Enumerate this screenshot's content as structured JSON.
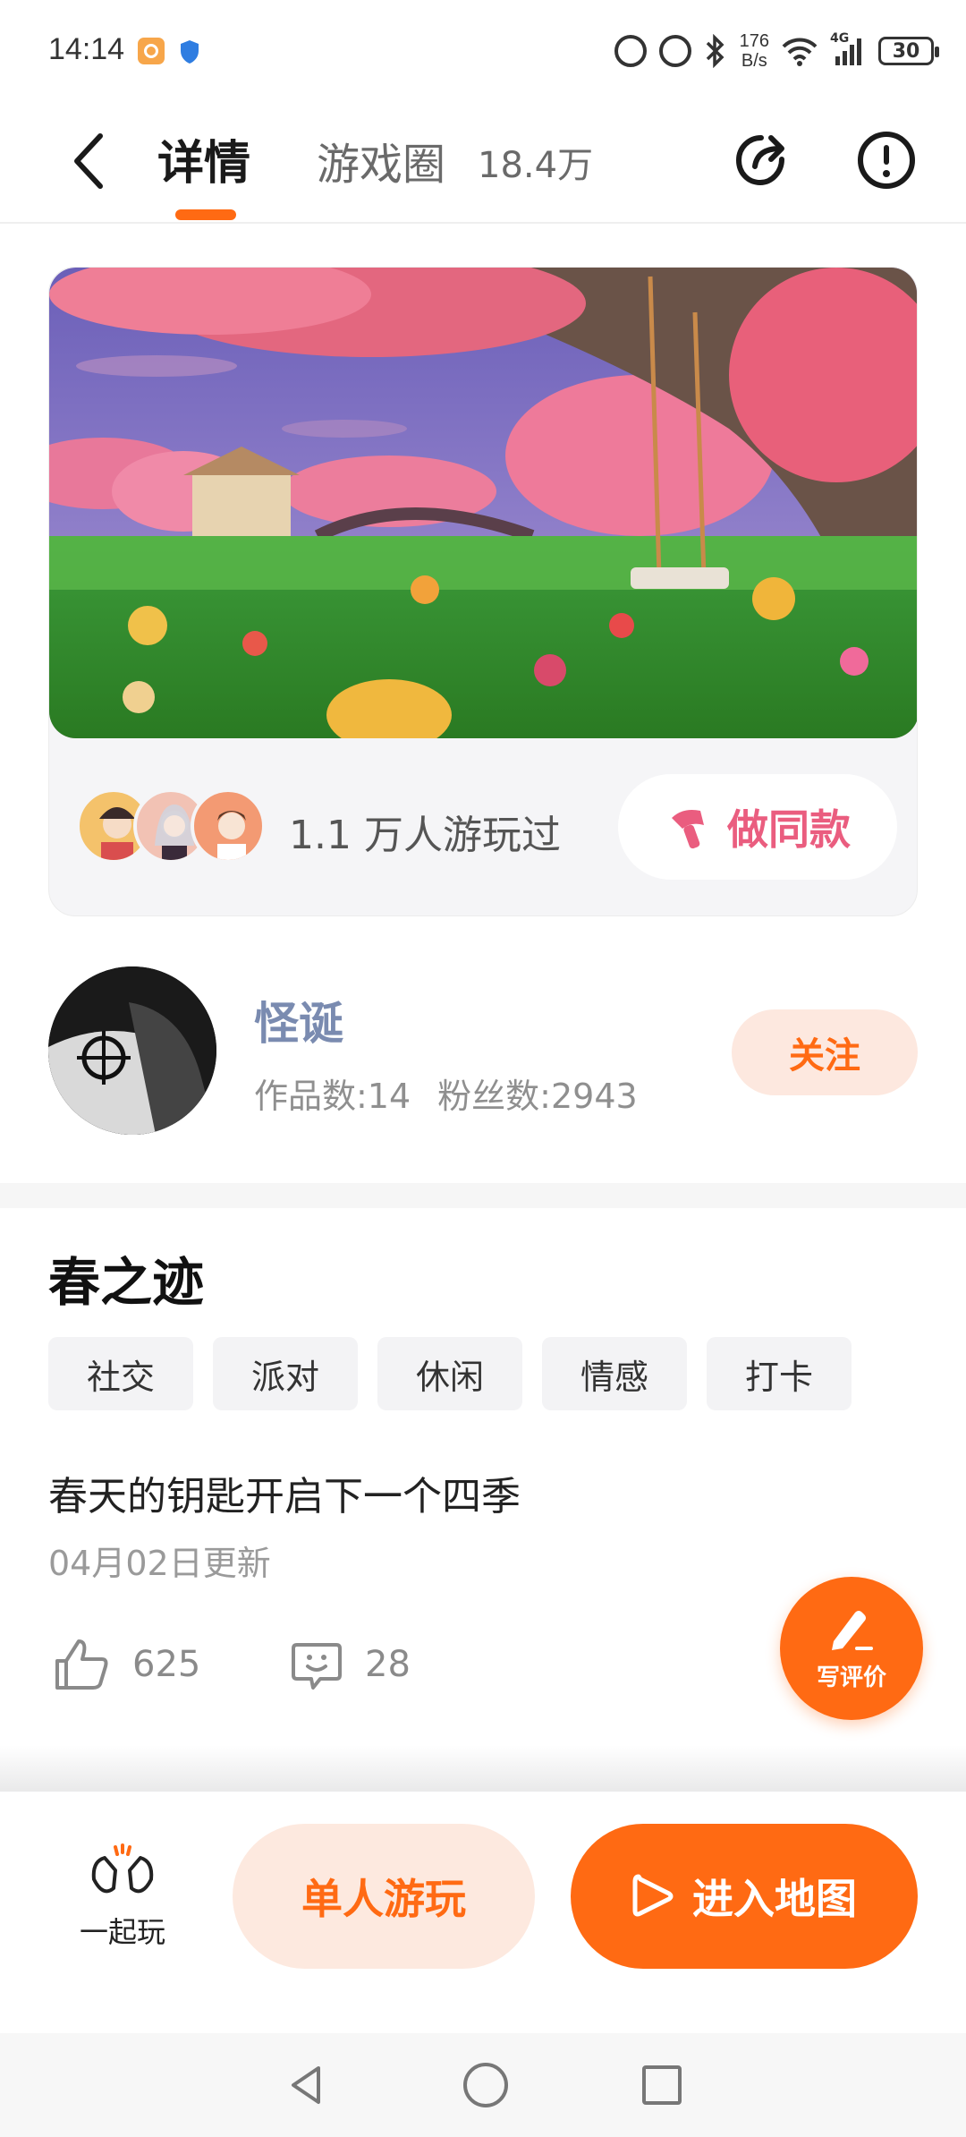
{
  "status_bar": {
    "time": "14:14",
    "net_speed_value": "176",
    "net_speed_unit": "B/s",
    "network": "4G",
    "battery": "30"
  },
  "nav": {
    "tab_detail": "详情",
    "tab_circle": "游戏圈",
    "tab_circle_count": "18.4万"
  },
  "game_card": {
    "played_text": "1.1 万人游玩过",
    "make_same_label": "做同款"
  },
  "author": {
    "name": "怪诞",
    "works": "作品数:14",
    "fans": "粉丝数:2943",
    "follow_label": "关注"
  },
  "game": {
    "title": "春之迹",
    "tags": [
      "社交",
      "派对",
      "休闲",
      "情感",
      "打卡"
    ],
    "description": "春天的钥匙开启下一个四季",
    "updated": "04月02日更新",
    "likes": "625",
    "comments": "28",
    "review_label": "写评价"
  },
  "actions": {
    "together_label": "一起玩",
    "solo_label": "单人游玩",
    "enter_label": "进入地图"
  },
  "colors": {
    "accent": "#ff6a13",
    "accent_soft": "#fde9df",
    "make_same": "#ea5d7f",
    "author_name": "#7a8bb0"
  }
}
